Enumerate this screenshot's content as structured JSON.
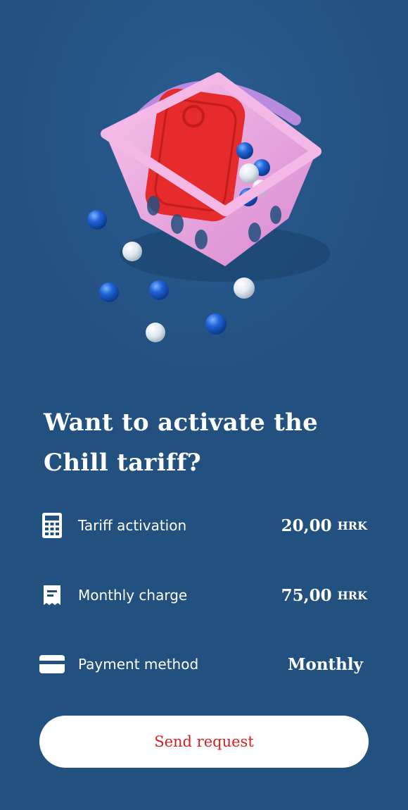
{
  "title_line1": "Want to activate the",
  "title_line2": "Chill tariff?",
  "rows": [
    {
      "icon": "calculator-icon",
      "label": "Tariff activation",
      "value": "20,00",
      "currency": "HRK"
    },
    {
      "icon": "receipt-icon",
      "label": "Monthly charge",
      "value": "75,00",
      "currency": "HRK"
    },
    {
      "icon": "credit-card-icon",
      "label": "Payment method",
      "value": "Monthly",
      "currency": ""
    }
  ],
  "button_label": "Send request",
  "colors": {
    "background": "#22507f",
    "button_bg": "#ffffff",
    "button_text": "#d61f1f",
    "text": "#ffffff"
  }
}
